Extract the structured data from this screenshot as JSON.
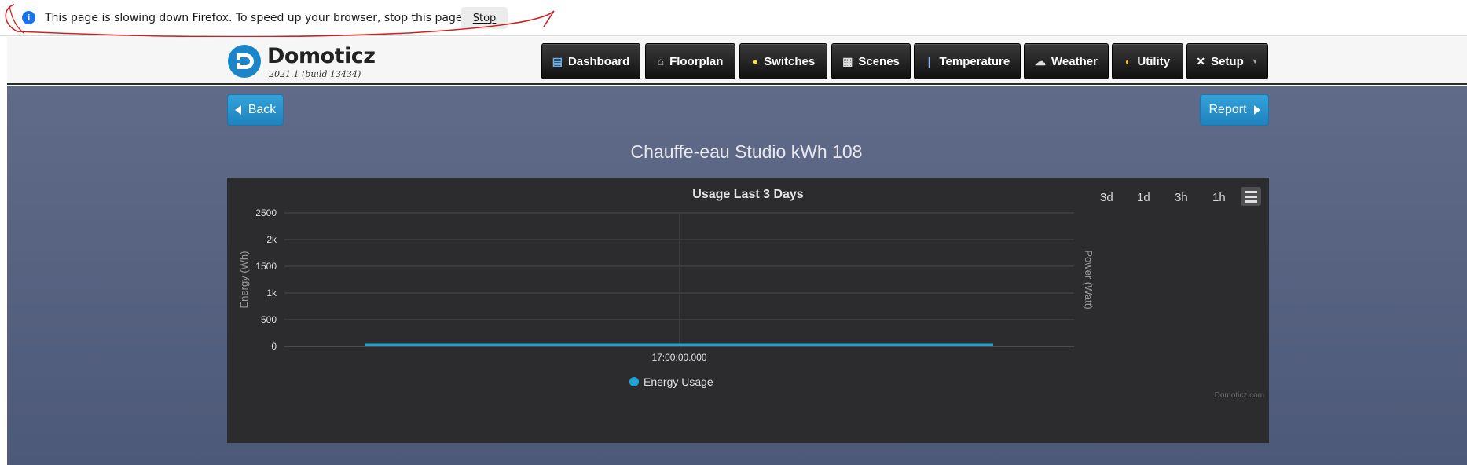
{
  "browser_notification": {
    "message": "This page is slowing down Firefox. To speed up your browser, stop this page.",
    "stop_label": "Stop",
    "info_icon": "info-icon",
    "info_symbol": "i"
  },
  "header": {
    "brand": "Domoticz",
    "version": "2021.1 (build 13434)",
    "nav": [
      {
        "label": "Dashboard",
        "icon": "dashboard-icon"
      },
      {
        "label": "Floorplan",
        "icon": "floorplan-icon"
      },
      {
        "label": "Switches",
        "icon": "lightbulb-icon"
      },
      {
        "label": "Scenes",
        "icon": "clapperboard-icon"
      },
      {
        "label": "Temperature",
        "icon": "thermometer-icon"
      },
      {
        "label": "Weather",
        "icon": "cloud-rain-icon"
      },
      {
        "label": "Utility",
        "icon": "utility-icon"
      },
      {
        "label": "Setup",
        "icon": "tools-icon"
      }
    ]
  },
  "main": {
    "back_label": "Back",
    "report_label": "Report",
    "device_title": "Chauffe-eau Studio kWh 108"
  },
  "colors": {
    "accent_blue": "#2a93d0",
    "series_color": "#1ea3d8",
    "chart_bg": "#2c2c2e",
    "page_bg": "#56627f"
  },
  "chart_data": {
    "type": "line",
    "title": "Usage Last 3 Days",
    "range_buttons": [
      "3d",
      "1d",
      "3h",
      "1h"
    ],
    "ylabel": "Energy (Wh)",
    "ylabel_right": "Power (Watt)",
    "ylim": [
      0,
      2500
    ],
    "y_ticks": [
      "2500",
      "2k",
      "1500",
      "1k",
      "500",
      "0"
    ],
    "x_ticks": [
      "17:00:00.000"
    ],
    "series": [
      {
        "name": "Energy Usage",
        "values": [
          0,
          0
        ]
      }
    ],
    "legend": "bottom-center",
    "credit": "Domoticz.com",
    "grid": true
  }
}
